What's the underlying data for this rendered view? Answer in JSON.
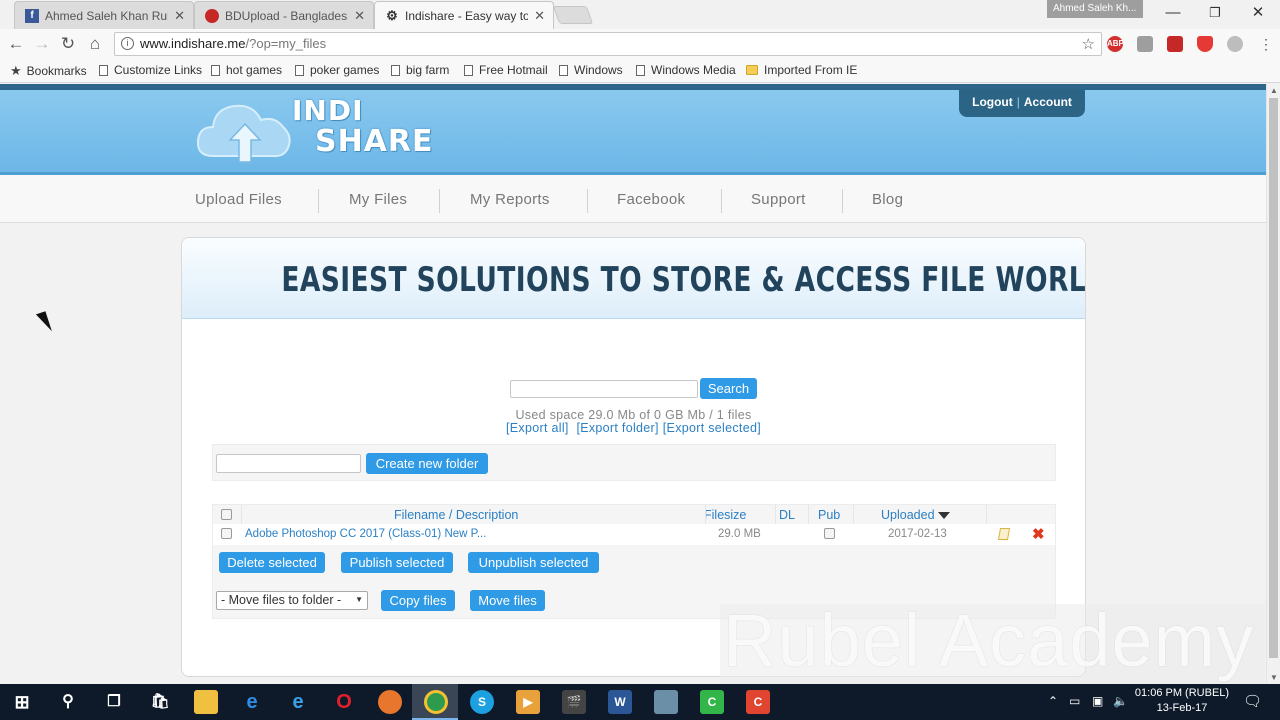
{
  "browser": {
    "tabs": [
      {
        "title": "Ahmed Saleh Khan Rube",
        "favicon": "facebook-favicon",
        "color": "#3b5998",
        "active": false
      },
      {
        "title": "BDUpload - Bangladesh",
        "favicon": "bdupload-favicon",
        "color": "#c62828",
        "active": false
      },
      {
        "title": "Indishare - Easy way to s",
        "favicon": "indishare-favicon",
        "color": "#333333",
        "active": true
      }
    ],
    "profile_name": "Ahmed Saleh Kh...",
    "url_host": "www.indishare.me",
    "url_path": "/?op=my_files",
    "bookmarks": [
      {
        "label": "Bookmarks",
        "icon": "star-icon"
      },
      {
        "label": "Customize Links",
        "icon": "page-icon"
      },
      {
        "label": "hot games",
        "icon": "page-icon"
      },
      {
        "label": "poker games",
        "icon": "page-icon"
      },
      {
        "label": "big farm",
        "icon": "page-icon"
      },
      {
        "label": "Free Hotmail",
        "icon": "page-icon"
      },
      {
        "label": "Windows",
        "icon": "page-icon"
      },
      {
        "label": "Windows Media",
        "icon": "page-icon"
      },
      {
        "label": "Imported From IE",
        "icon": "folder-icon"
      }
    ],
    "extensions": [
      "ABP",
      "",
      "",
      "",
      ""
    ]
  },
  "site": {
    "logo_top": "INDI",
    "logo_bottom": "SHARE",
    "logout_label": "Logout",
    "account_label": "Account",
    "nav": [
      "Upload Files",
      "My Files",
      "My Reports",
      "Facebook",
      "Support",
      "Blog"
    ],
    "hero_text": "EASIEST SOLUTIONS TO STORE & ACCESS FILE WORLD-WIDE",
    "search_button": "Search",
    "used_space": "Used space 29.0 Mb of 0 GB Mb / 1 files",
    "export_all": "[Export all]",
    "export_folder": "[Export folder]",
    "export_selected": "[Export selected]",
    "create_folder_button": "Create new folder",
    "table": {
      "headers": {
        "filename": "Filename / Description",
        "filesize": "Filesize",
        "dl": "DL",
        "pub": "Pub",
        "uploaded": "Uploaded"
      },
      "rows": [
        {
          "filename": "Adobe Photoshop CC 2017 (Class-01) New P...",
          "filesize": "29.0 MB",
          "uploaded": "2017-02-13"
        }
      ]
    },
    "delete_selected": "Delete selected",
    "publish_selected": "Publish selected",
    "unpublish_selected": "Unpublish selected",
    "move_select": "- Move files to folder -",
    "copy_files": "Copy files",
    "move_files": "Move files"
  },
  "watermark": "Rubel Academy",
  "taskbar": {
    "time": "01:06 PM (RUBEL)",
    "date": "13-Feb-17"
  },
  "colors": {
    "accent_blue": "#2f9ae6",
    "header_dark": "#2c6486",
    "link_blue": "#2b80c5"
  }
}
